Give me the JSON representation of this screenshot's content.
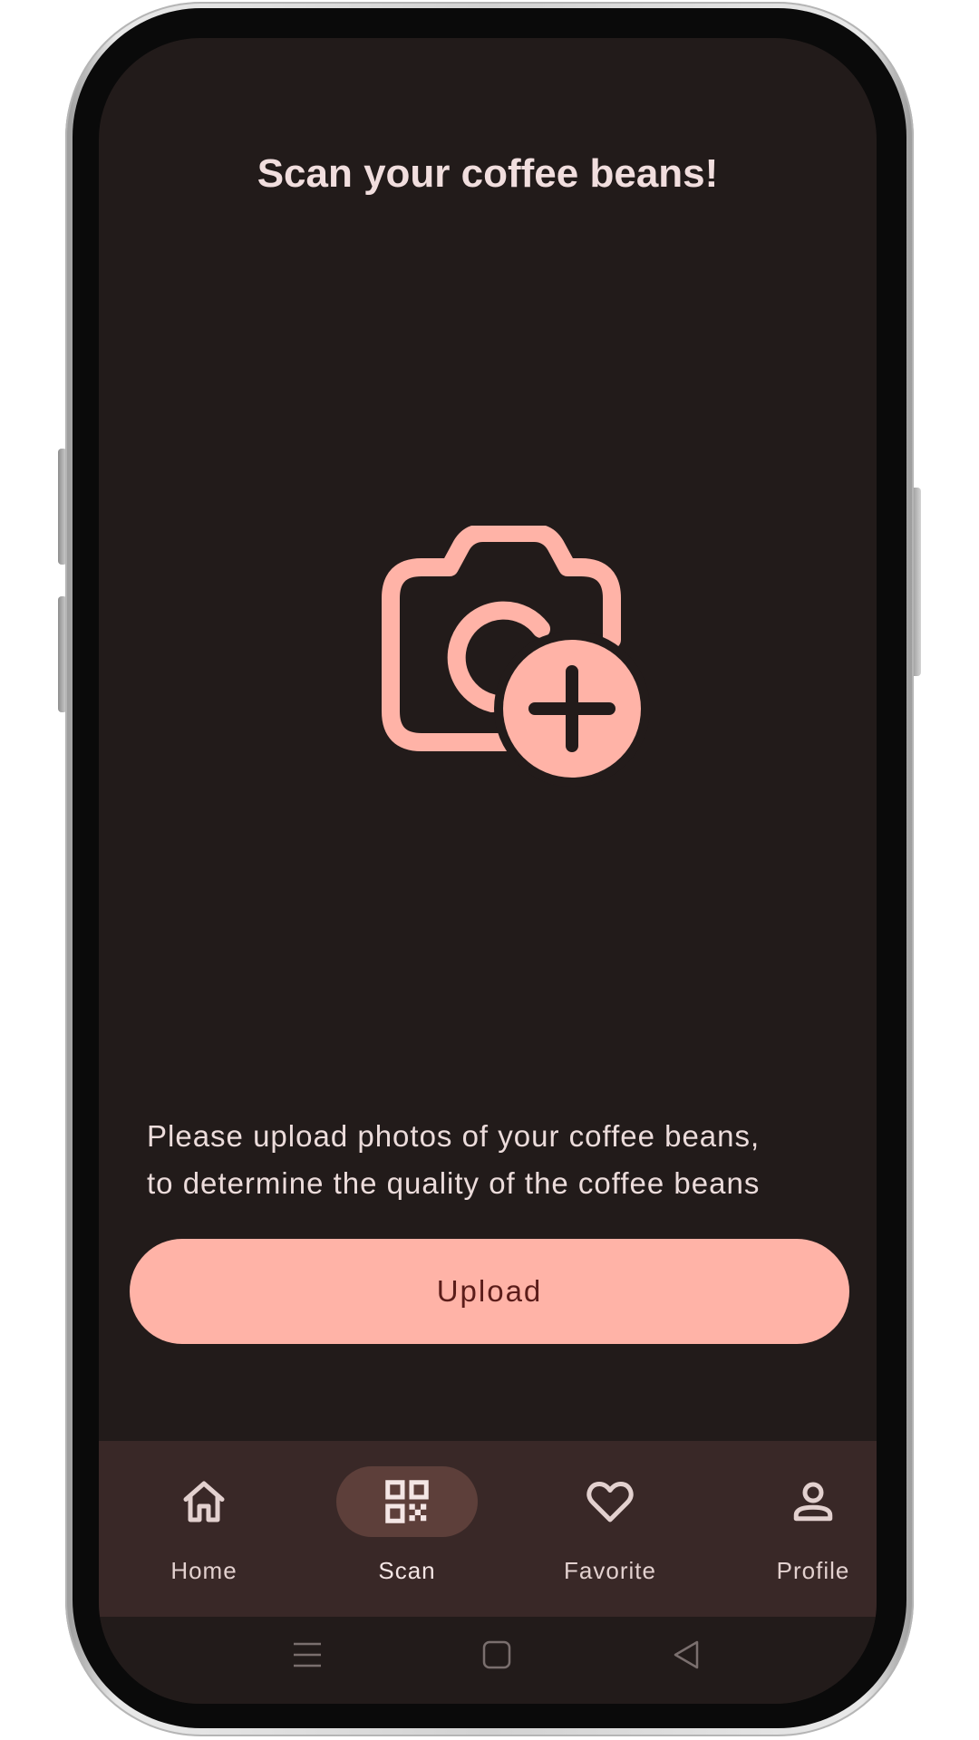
{
  "header": {
    "title": "Scan your coffee beans!"
  },
  "main": {
    "icon": "add-photo-camera-icon",
    "instructions_line1": "Please upload photos of your coffee beans,",
    "instructions_line2": "to determine the quality of the coffee beans",
    "upload_label": "Upload"
  },
  "bottom_nav": {
    "items": [
      {
        "label": "Home",
        "icon": "home-icon",
        "active": false
      },
      {
        "label": "Scan",
        "icon": "qr-code-icon",
        "active": true
      },
      {
        "label": "Favorite",
        "icon": "heart-icon",
        "active": false
      },
      {
        "label": "Profile",
        "icon": "person-icon",
        "active": false
      }
    ]
  },
  "system_nav": {
    "icons": [
      "recents-icon",
      "home-square-icon",
      "back-triangle-icon"
    ]
  },
  "colors": {
    "background": "#221b1a",
    "accent": "#ffb3a7",
    "nav_bar": "#392827",
    "nav_active_pill": "#5d3f3a",
    "text": "#ecdcdb"
  }
}
